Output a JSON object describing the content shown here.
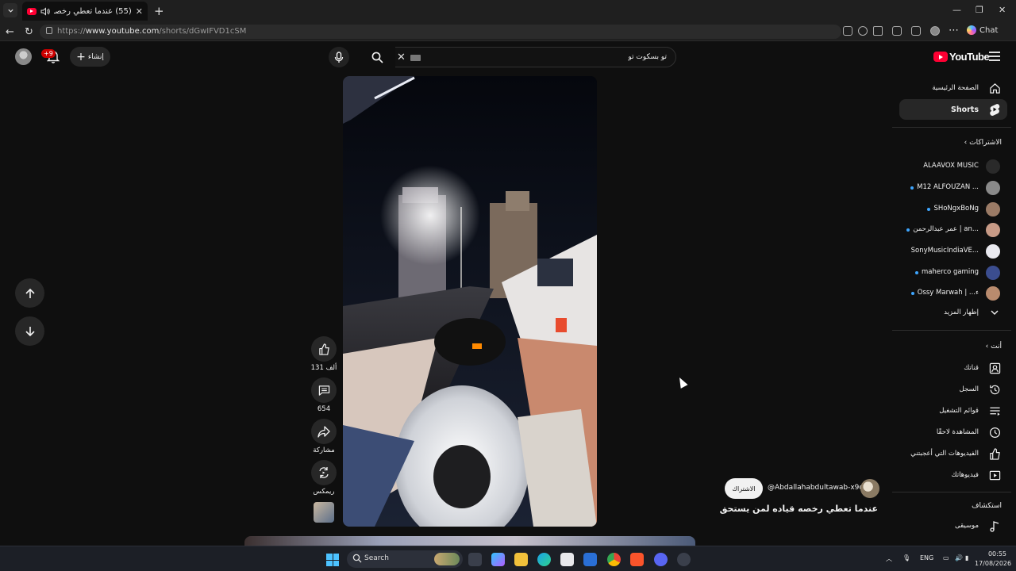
{
  "browser": {
    "tab_title": "(55) عندما تعطي رخصه قياده لـ",
    "url_prefix": "https://",
    "url_domain": "www.youtube.com",
    "url_path": "/shorts/dGwIFVD1cSM",
    "chat_label": "Chat"
  },
  "header": {
    "notification_count": "+9",
    "create_label": "إنشاء",
    "search_value": "تو بسكوت تو",
    "logo_text": "YouTube"
  },
  "short": {
    "likes": "131 ألف",
    "comments": "654",
    "share_label": "مشاركة",
    "remix_label": "ريمكس",
    "subscribe_label": "الاشتراك",
    "channel_handle": "@Abdallahabdultawab-x9d",
    "title": "عندما تعطي رخصه قياده لمن يستحق"
  },
  "sidebar": {
    "home": "الصفحة الرئيسية",
    "shorts": "Shorts",
    "subscriptions_header": "الاشتراكات",
    "subscriptions": [
      {
        "name": "ALAAVOX MUSIC",
        "dot": false,
        "color": "#2a2a2a"
      },
      {
        "name": "M12 ALFOUZAN ...",
        "dot": true,
        "color": "#8a8a8a"
      },
      {
        "name": "SHoNgxBoNg",
        "dot": true,
        "color": "#9b7b66"
      },
      {
        "name": "عمر عبدالرحمن | an...",
        "dot": true,
        "color": "#c79a86"
      },
      {
        "name": "SonyMusicIndiaVE...",
        "dot": false,
        "color": "#e9e9ef"
      },
      {
        "name": "maherco gaming",
        "dot": true,
        "color": "#3b4d8f"
      },
      {
        "name": "Ossy Marwah | ...ء",
        "dot": true,
        "color": "#b98b6e"
      }
    ],
    "show_more": "إظهار المزيد",
    "you_header": "أنت",
    "you_items": [
      "قناتك",
      "السجل",
      "قوائم التشغيل",
      "المشاهدة لاحقًا",
      "الفيديوهات التي أعجبتني",
      "فيديوهاتك"
    ],
    "explore_header": "استكشاف",
    "music": "موسيقى"
  },
  "taskbar": {
    "search_label": "Search",
    "language": "ENG",
    "time": "00:55",
    "date": "17/08/2026"
  }
}
